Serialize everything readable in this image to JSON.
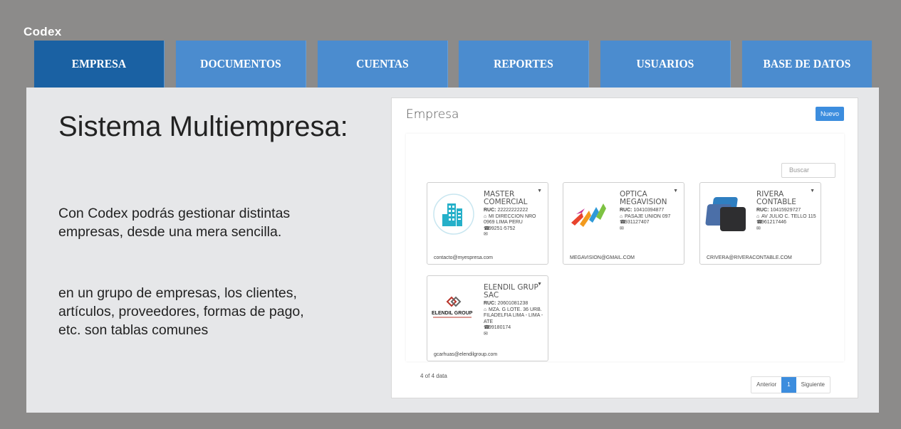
{
  "brand": "Codex",
  "nav": [
    "EMPRESA",
    "DOCUMENTOS",
    "CUENTAS",
    "REPORTES",
    "USUARIOS",
    "BASE DE DATOS"
  ],
  "hero": {
    "title": "Sistema Multiempresa:",
    "p1": "Con Codex podrás gestionar distintas empresas, desde una mera sencilla.",
    "p2": "en un grupo de empresas, los clientes, artículos, proveedores, formas de pago, etc. son tablas comunes"
  },
  "panel": {
    "title": "Empresa",
    "new_button": "Nuevo",
    "search_placeholder": "Buscar",
    "count_text": "4 of 4 data",
    "prev": "Anterior",
    "page": "1",
    "next": "Siguiente"
  },
  "companies": [
    {
      "name": "MASTER COMERCIAL",
      "ruc_label": "RUC:",
      "ruc": "22222222222",
      "address": "MI DIRECCION NRO 0969 LIMA PERU",
      "phone": "99251-5752",
      "email": "contacto@myespresa.com",
      "logo": "building-icon"
    },
    {
      "name": "OPTICA MEGAVISION",
      "ruc_label": "RUC:",
      "ruc": "10410394877",
      "address": "PASAJE UNION 097",
      "phone": "931127407",
      "email": "MEGAVISION@GMAIL.COM",
      "logo": "arrows-logo"
    },
    {
      "name": "RIVERA CONTABLE",
      "ruc_label": "RUC:",
      "ruc": "10415929727",
      "address": "AV JULIO C. TELLO 115",
      "phone": "961217446",
      "email": "CRIVERA@RIVERACONTABLE.COM",
      "logo": "squares-logo"
    },
    {
      "name": "ELENDIL GRUP SAC",
      "ruc_label": "RUC:",
      "ruc": "20601081238",
      "address": "MZA. G LOTE. 36 URB. FILADELFIA LIMA - LIMA - ATE",
      "phone": "99180174",
      "email": "gcarhuas@elendilgroup.com",
      "logo": "elendil-logo",
      "logo_text": "ELENDIL GROUP"
    }
  ]
}
